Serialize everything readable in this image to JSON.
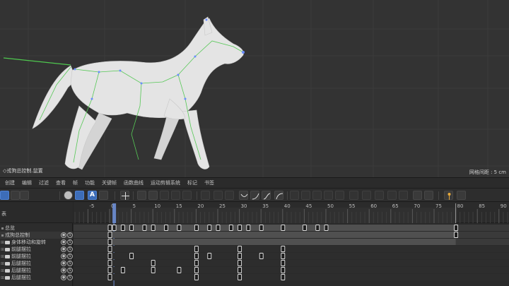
{
  "viewport": {
    "object_label": "◇戎狗总控制.鼠置",
    "grid_info": "网格间距 : 5 cm"
  },
  "menubar": [
    "创建",
    "编辑",
    "过滤",
    "查看",
    "帧",
    "功能",
    "关键帧",
    "函数曲线",
    "运动剪辑系统",
    "标记",
    "书签"
  ],
  "left_panel": {
    "title": "表",
    "tree": [
      {
        "label": "总览",
        "expander": "",
        "folder": false,
        "icons": false
      },
      {
        "label": "戎狗总控制",
        "expander": "",
        "folder": false,
        "icons": true,
        "selected": true
      },
      {
        "label": "身体移动和旋转",
        "expander": "⊞",
        "folder": true,
        "icons": true
      },
      {
        "label": "前腿摆拉",
        "expander": "⊞",
        "folder": true,
        "icons": true
      },
      {
        "label": "前腿摆拉",
        "expander": "⊞",
        "folder": true,
        "icons": true
      },
      {
        "label": "后腿摆拉",
        "expander": "⊞",
        "folder": true,
        "icons": true
      },
      {
        "label": "后腿摆拉",
        "expander": "⊞",
        "folder": true,
        "icons": true
      },
      {
        "label": "后腿摆拉",
        "expander": "⊞",
        "folder": true,
        "icons": true
      }
    ]
  },
  "timeline": {
    "ruler_labels": [
      "-5",
      "0",
      "5",
      "10",
      "15",
      "20",
      "25",
      "30",
      "35",
      "40",
      "45",
      "50",
      "55",
      "60",
      "65",
      "70",
      "75",
      "80",
      "85",
      "90"
    ],
    "current_frame": 1,
    "range_end": 80,
    "keyframe_rows": [
      {
        "frames": [
          0,
          1,
          3,
          5,
          8,
          10,
          13,
          16,
          20,
          23,
          25,
          28,
          30,
          32,
          35,
          40,
          45,
          48,
          50,
          80
        ],
        "shaded": true
      },
      {
        "frames": [
          0,
          80
        ],
        "shaded": true
      },
      {
        "frames": [
          0
        ],
        "shaded": true
      },
      {
        "frames": [
          0,
          20,
          30,
          40
        ],
        "shaded": false
      },
      {
        "frames": [
          0,
          5,
          20,
          23,
          30,
          35,
          40
        ],
        "shaded": false
      },
      {
        "frames": [
          0,
          10,
          20,
          30,
          40
        ],
        "shaded": false
      },
      {
        "frames": [
          0,
          3,
          10,
          16,
          20,
          30,
          40
        ],
        "shaded": false
      },
      {
        "frames": [
          0,
          20,
          30,
          40
        ],
        "shaded": false
      }
    ]
  },
  "colors": {
    "viewport_bg": "#333333",
    "accent_blue": "#3d6db8",
    "playhead": "#6e8fd6",
    "key_fill": "#1e1e1e",
    "key_stroke": "#e6e6e6"
  }
}
